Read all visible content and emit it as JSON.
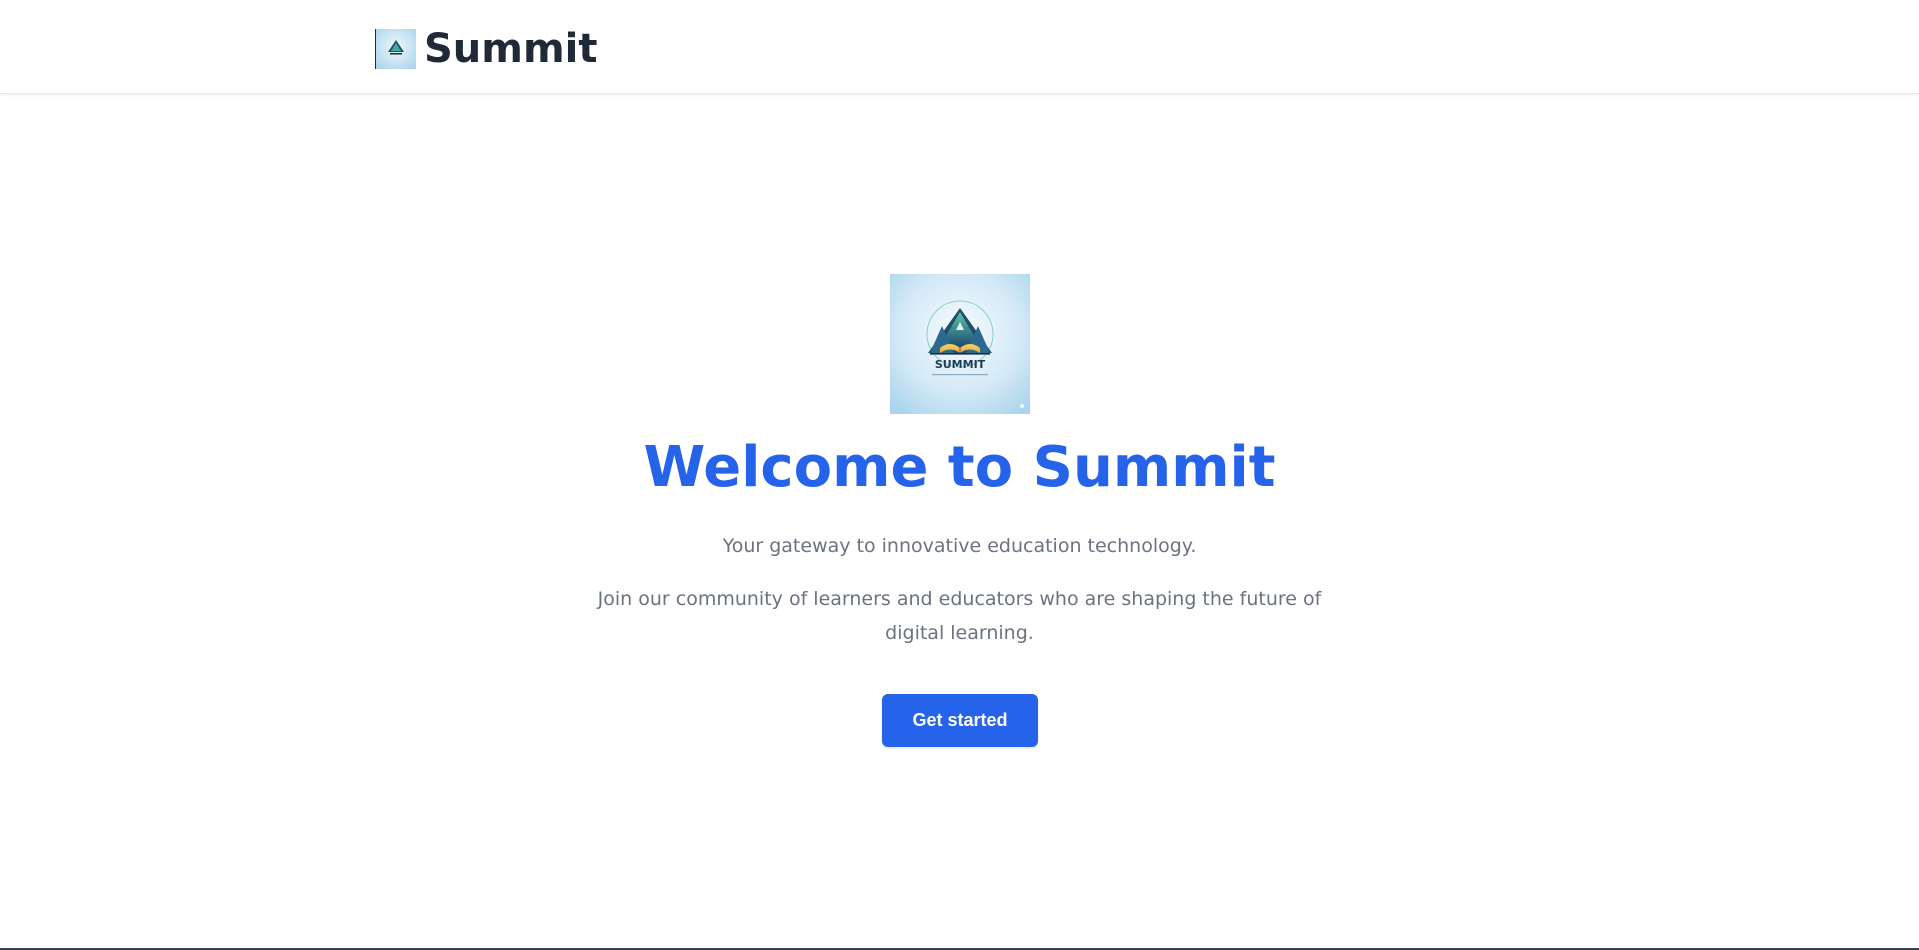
{
  "header": {
    "brand_name": "Summit",
    "logo_icon": "summit-mountain-logo-icon"
  },
  "hero": {
    "logo_icon": "summit-mountain-logo-icon",
    "logo_text": "SUMMIT",
    "title": "Welcome to Summit",
    "tagline": "Your gateway to innovative education technology.",
    "description": "Join our community of learners and educators who are shaping the future of digital learning.",
    "cta_label": "Get started"
  },
  "colors": {
    "accent": "#2563eb",
    "heading_dark": "#1f2937",
    "muted_text": "#6b7280",
    "logo_bg_light": "#e6f3fa",
    "logo_bg_dark": "#a9d4ec"
  }
}
